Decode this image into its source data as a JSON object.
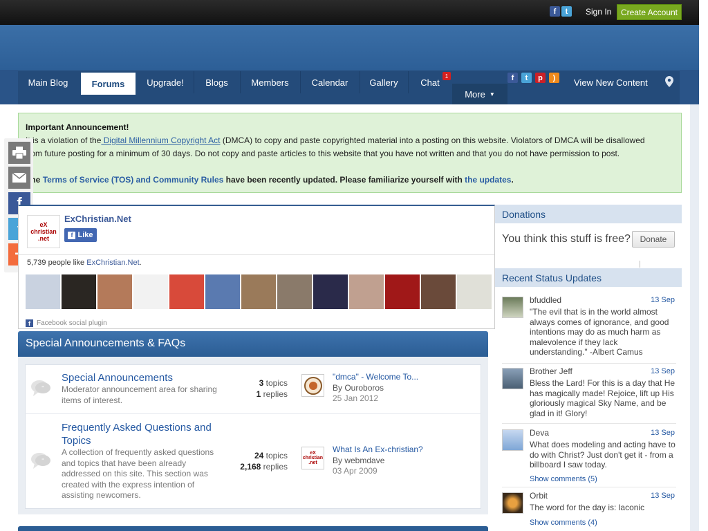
{
  "topbar": {
    "signin": "Sign In",
    "create_account": "Create Account",
    "social_icons": [
      "facebook-icon",
      "twitter-icon"
    ]
  },
  "nav": {
    "items": [
      "Main Blog",
      "Forums",
      "Upgrade!",
      "Blogs",
      "Members",
      "Calendar",
      "Gallery",
      "Chat"
    ],
    "active": "Forums",
    "chat_badge": "1",
    "more": "More",
    "view_new": "View New Content",
    "social_icons": [
      "facebook-icon",
      "twitter-icon",
      "pinterest-icon",
      "rss-icon"
    ]
  },
  "announcement": {
    "title": "Important Announcement!",
    "line1_pre": "It is a violation of the",
    "line1_link": " Digital Millennium Copyright Act",
    "line1_post": " (DMCA) to copy and paste copyrighted material into a posting on this website. Violators of DMCA will be disallowed",
    "line2": "from future posting for a minimum of 30 days. Do not copy and paste articles to this website that you have not written and that you do not have permission to post.",
    "line3_pre": "The",
    "line3_link": "Terms of Service (TOS) and Community Rules",
    "line3_mid": "have been recently updated. Please familiarize yourself with",
    "line3_link2": "the updates",
    "line3_end": "."
  },
  "facebook": {
    "page_name": "ExChristian.Net",
    "logo_text": "eX christian .net",
    "like": "Like",
    "people_pre": "5,739 people like",
    "people_link": "ExChristian.Net",
    "people_end": ".",
    "plugin": "Facebook social plugin",
    "faces_count": 13
  },
  "category": {
    "title": "Special Announcements & FAQs",
    "forums": [
      {
        "title": "Special Announcements",
        "description": "Moderator announcement area for sharing items of interest.",
        "topics_num": "3",
        "topics_label": "topics",
        "replies_num": "1",
        "replies_label": "replies",
        "last_title": "\"dmca\" - Welcome To...",
        "last_by": "By Ouroboros",
        "last_date": "25 Jan 2012"
      },
      {
        "title": "Frequently Asked Questions and Topics",
        "description": "A collection of frequently asked questions and topics that have been already addressed on this site. This section was created with the express intention of assisting newcomers.",
        "topics_num": "24",
        "topics_label": "topics",
        "replies_num": "2,168",
        "replies_label": "replies",
        "last_title": "What Is An Ex-christian?",
        "last_by": "By webmdave",
        "last_date": "03 Apr 2009"
      }
    ]
  },
  "sidebar": {
    "donations_title": "Donations",
    "donations_text": "You think this stuff is free?",
    "donate_button": "Donate",
    "status_title": "Recent Status Updates",
    "statuses": [
      {
        "name": "bfuddled",
        "date": "13 Sep",
        "text": "\"The evil that is in the world almost always comes of ignorance, and good intentions may do as much harm as malevolence if they lack understanding.\" -Albert Camus",
        "comments": ""
      },
      {
        "name": "Brother Jeff",
        "date": "13 Sep",
        "text": "Bless the Lard! For this is a day that He has magically made! Rejoice, lift up His gloriously magical Sky Name, and be glad in it! Glory!",
        "comments": ""
      },
      {
        "name": "Deva",
        "date": "13 Sep",
        "text": "What does modeling and acting have to do with Christ? Just don't get it - from a billboard I saw today.",
        "comments": "Show comments (5)"
      },
      {
        "name": "Orbit",
        "date": "13 Sep",
        "text": "The word for the day is: laconic",
        "comments": "Show comments (4)"
      }
    ]
  },
  "sharebar": [
    "print-icon",
    "email-icon",
    "facebook-icon",
    "twitter-icon",
    "more-share-icon"
  ]
}
